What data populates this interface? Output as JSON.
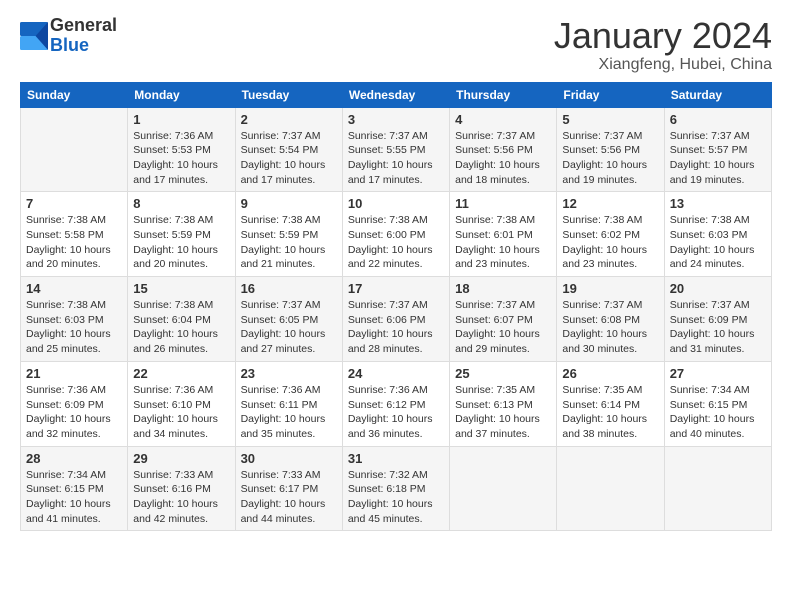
{
  "logo": {
    "line1": "General",
    "line2": "Blue"
  },
  "title": "January 2024",
  "subtitle": "Xiangfeng, Hubei, China",
  "days_of_week": [
    "Sunday",
    "Monday",
    "Tuesday",
    "Wednesday",
    "Thursday",
    "Friday",
    "Saturday"
  ],
  "weeks": [
    [
      {
        "day": "",
        "info": ""
      },
      {
        "day": "1",
        "info": "Sunrise: 7:36 AM\nSunset: 5:53 PM\nDaylight: 10 hours\nand 17 minutes."
      },
      {
        "day": "2",
        "info": "Sunrise: 7:37 AM\nSunset: 5:54 PM\nDaylight: 10 hours\nand 17 minutes."
      },
      {
        "day": "3",
        "info": "Sunrise: 7:37 AM\nSunset: 5:55 PM\nDaylight: 10 hours\nand 17 minutes."
      },
      {
        "day": "4",
        "info": "Sunrise: 7:37 AM\nSunset: 5:56 PM\nDaylight: 10 hours\nand 18 minutes."
      },
      {
        "day": "5",
        "info": "Sunrise: 7:37 AM\nSunset: 5:56 PM\nDaylight: 10 hours\nand 19 minutes."
      },
      {
        "day": "6",
        "info": "Sunrise: 7:37 AM\nSunset: 5:57 PM\nDaylight: 10 hours\nand 19 minutes."
      }
    ],
    [
      {
        "day": "7",
        "info": "Sunrise: 7:38 AM\nSunset: 5:58 PM\nDaylight: 10 hours\nand 20 minutes."
      },
      {
        "day": "8",
        "info": "Sunrise: 7:38 AM\nSunset: 5:59 PM\nDaylight: 10 hours\nand 20 minutes."
      },
      {
        "day": "9",
        "info": "Sunrise: 7:38 AM\nSunset: 5:59 PM\nDaylight: 10 hours\nand 21 minutes."
      },
      {
        "day": "10",
        "info": "Sunrise: 7:38 AM\nSunset: 6:00 PM\nDaylight: 10 hours\nand 22 minutes."
      },
      {
        "day": "11",
        "info": "Sunrise: 7:38 AM\nSunset: 6:01 PM\nDaylight: 10 hours\nand 23 minutes."
      },
      {
        "day": "12",
        "info": "Sunrise: 7:38 AM\nSunset: 6:02 PM\nDaylight: 10 hours\nand 23 minutes."
      },
      {
        "day": "13",
        "info": "Sunrise: 7:38 AM\nSunset: 6:03 PM\nDaylight: 10 hours\nand 24 minutes."
      }
    ],
    [
      {
        "day": "14",
        "info": "Sunrise: 7:38 AM\nSunset: 6:03 PM\nDaylight: 10 hours\nand 25 minutes."
      },
      {
        "day": "15",
        "info": "Sunrise: 7:38 AM\nSunset: 6:04 PM\nDaylight: 10 hours\nand 26 minutes."
      },
      {
        "day": "16",
        "info": "Sunrise: 7:37 AM\nSunset: 6:05 PM\nDaylight: 10 hours\nand 27 minutes."
      },
      {
        "day": "17",
        "info": "Sunrise: 7:37 AM\nSunset: 6:06 PM\nDaylight: 10 hours\nand 28 minutes."
      },
      {
        "day": "18",
        "info": "Sunrise: 7:37 AM\nSunset: 6:07 PM\nDaylight: 10 hours\nand 29 minutes."
      },
      {
        "day": "19",
        "info": "Sunrise: 7:37 AM\nSunset: 6:08 PM\nDaylight: 10 hours\nand 30 minutes."
      },
      {
        "day": "20",
        "info": "Sunrise: 7:37 AM\nSunset: 6:09 PM\nDaylight: 10 hours\nand 31 minutes."
      }
    ],
    [
      {
        "day": "21",
        "info": "Sunrise: 7:36 AM\nSunset: 6:09 PM\nDaylight: 10 hours\nand 32 minutes."
      },
      {
        "day": "22",
        "info": "Sunrise: 7:36 AM\nSunset: 6:10 PM\nDaylight: 10 hours\nand 34 minutes."
      },
      {
        "day": "23",
        "info": "Sunrise: 7:36 AM\nSunset: 6:11 PM\nDaylight: 10 hours\nand 35 minutes."
      },
      {
        "day": "24",
        "info": "Sunrise: 7:36 AM\nSunset: 6:12 PM\nDaylight: 10 hours\nand 36 minutes."
      },
      {
        "day": "25",
        "info": "Sunrise: 7:35 AM\nSunset: 6:13 PM\nDaylight: 10 hours\nand 37 minutes."
      },
      {
        "day": "26",
        "info": "Sunrise: 7:35 AM\nSunset: 6:14 PM\nDaylight: 10 hours\nand 38 minutes."
      },
      {
        "day": "27",
        "info": "Sunrise: 7:34 AM\nSunset: 6:15 PM\nDaylight: 10 hours\nand 40 minutes."
      }
    ],
    [
      {
        "day": "28",
        "info": "Sunrise: 7:34 AM\nSunset: 6:15 PM\nDaylight: 10 hours\nand 41 minutes."
      },
      {
        "day": "29",
        "info": "Sunrise: 7:33 AM\nSunset: 6:16 PM\nDaylight: 10 hours\nand 42 minutes."
      },
      {
        "day": "30",
        "info": "Sunrise: 7:33 AM\nSunset: 6:17 PM\nDaylight: 10 hours\nand 44 minutes."
      },
      {
        "day": "31",
        "info": "Sunrise: 7:32 AM\nSunset: 6:18 PM\nDaylight: 10 hours\nand 45 minutes."
      },
      {
        "day": "",
        "info": ""
      },
      {
        "day": "",
        "info": ""
      },
      {
        "day": "",
        "info": ""
      }
    ]
  ]
}
